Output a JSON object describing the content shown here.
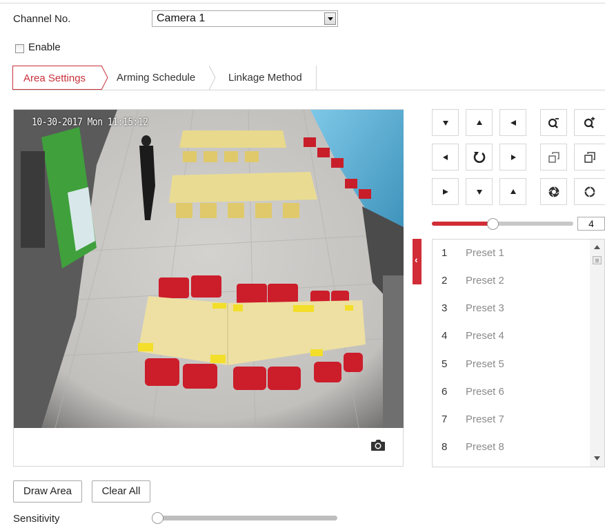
{
  "form": {
    "channel_label": "Channel No.",
    "channel_value": "Camera 1",
    "enable_label": "Enable",
    "enable_checked": false
  },
  "tabs": [
    {
      "label": "Area Settings",
      "active": true
    },
    {
      "label": "Arming Schedule",
      "active": false
    },
    {
      "label": "Linkage Method",
      "active": false
    }
  ],
  "video": {
    "osd_text": "10-30-2017 Mon 11:15:12"
  },
  "ptz": {
    "buttons": [
      "pan-up-left",
      "pan-up",
      "pan-up-right",
      "zoom-out",
      "zoom-in",
      "pan-left",
      "auto-rotate",
      "pan-right",
      "focus-near",
      "focus-far",
      "pan-down-left",
      "pan-down",
      "pan-down-right",
      "iris-close",
      "iris-open"
    ],
    "speed_value": "4",
    "speed_level": 0.43
  },
  "presets": [
    {
      "num": "1",
      "name": "Preset 1"
    },
    {
      "num": "2",
      "name": "Preset 2"
    },
    {
      "num": "3",
      "name": "Preset 3"
    },
    {
      "num": "4",
      "name": "Preset 4"
    },
    {
      "num": "5",
      "name": "Preset 5"
    },
    {
      "num": "6",
      "name": "Preset 6"
    },
    {
      "num": "7",
      "name": "Preset 7"
    },
    {
      "num": "8",
      "name": "Preset 8"
    }
  ],
  "actions": {
    "draw_area": "Draw Area",
    "clear_all": "Clear All"
  },
  "sensitivity": {
    "label": "Sensitivity",
    "level": 0
  },
  "colors": {
    "accent": "#d12d36",
    "tab_active_text": "#c9303a",
    "border": "#d6d6d6"
  }
}
